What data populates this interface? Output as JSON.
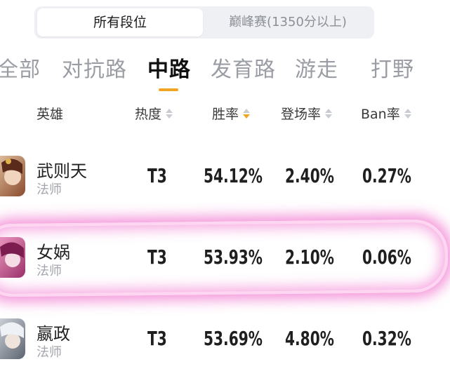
{
  "rank_filter": {
    "all_ranks": "所有段位",
    "peak": "巅峰赛(1350分以上)"
  },
  "lanes": [
    "全部",
    "对抗路",
    "中路",
    "发育路",
    "游走",
    "打野"
  ],
  "active_lane": "中路",
  "columns": {
    "hero": "英雄",
    "heat": "热度",
    "win_rate": "胜率",
    "pick_rate": "登场率",
    "ban_rate": "Ban率"
  },
  "heroes": [
    {
      "name": "武则天",
      "role": "法师",
      "heat": "T3",
      "win_rate": "54.12%",
      "pick_rate": "2.40%",
      "ban_rate": "0.27%"
    },
    {
      "name": "女娲",
      "role": "法师",
      "heat": "T3",
      "win_rate": "53.93%",
      "pick_rate": "2.10%",
      "ban_rate": "0.06%"
    },
    {
      "name": "嬴政",
      "role": "法师",
      "heat": "T3",
      "win_rate": "53.69%",
      "pick_rate": "4.80%",
      "ban_rate": "0.32%"
    }
  ],
  "colors": {
    "accent": "#f2a524",
    "highlight": "#eb46be"
  }
}
